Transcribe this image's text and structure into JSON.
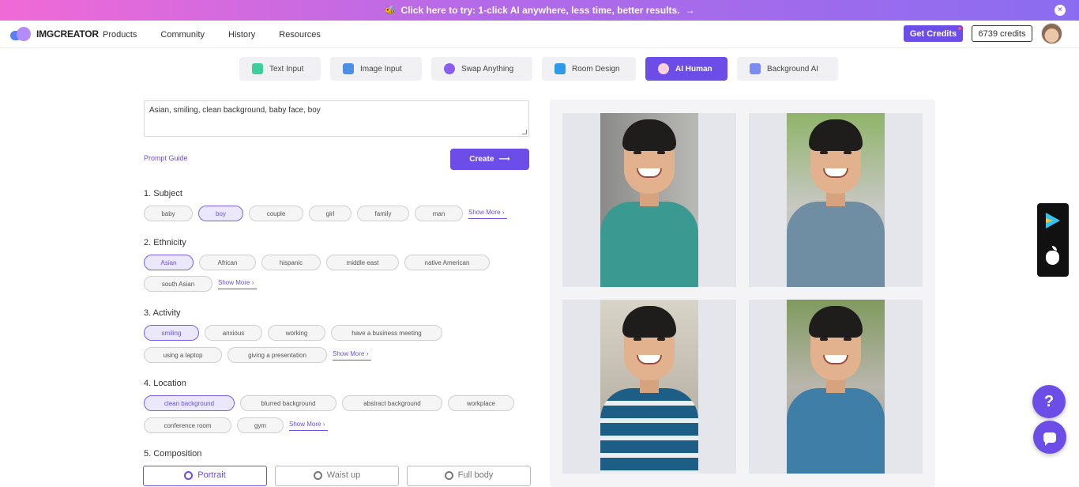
{
  "banner": {
    "text": "Click here to try: 1-click AI anywhere, less time, better results.",
    "arrow": "→",
    "close": "×"
  },
  "nav": {
    "logo": "IMGCREATOR",
    "links": [
      "Products",
      "Community",
      "History",
      "Resources"
    ],
    "get_credits": "Get Credits",
    "credits": "6739 credits"
  },
  "tabs": [
    {
      "label": "Text Input",
      "icon": "text-t-icon",
      "color": "#3ccf9b"
    },
    {
      "label": "Image Input",
      "icon": "image-icon",
      "color": "#4b8ee6"
    },
    {
      "label": "Swap Anything",
      "icon": "swap-icon",
      "color": "#8b5cf0"
    },
    {
      "label": "Room Design",
      "icon": "house-icon",
      "color": "#2d9be8"
    },
    {
      "label": "AI Human",
      "icon": "ai-human-icon",
      "color": "#ff6b8a"
    },
    {
      "label": "Background AI",
      "icon": "mountain-icon",
      "color": "#7a8cf0"
    }
  ],
  "prompt": {
    "value": "Asian, smiling, clean background, baby face, boy",
    "guide": "Prompt Guide",
    "create": "Create"
  },
  "sections": {
    "subject": {
      "title": "1. Subject",
      "chips": [
        "baby",
        "boy",
        "couple",
        "girl",
        "family",
        "man"
      ],
      "selected": "boy",
      "more": "Show More"
    },
    "ethnicity": {
      "title": "2. Ethnicity",
      "chips": [
        "Asian",
        "African",
        "hispanic",
        "middle east",
        "native American",
        "south Asian"
      ],
      "selected": "Asian",
      "more": "Show More"
    },
    "activity": {
      "title": "3. Activity",
      "chips": [
        "smiling",
        "anxious",
        "working",
        "have a business meeting",
        "using a laptop",
        "giving a presentation"
      ],
      "selected": "smiling",
      "more": "Show More"
    },
    "location": {
      "title": "4. Location",
      "chips": [
        "clean background",
        "blurred background",
        "abstract background",
        "workplace",
        "conference room",
        "gym"
      ],
      "selected": "clean background",
      "more": "Show More"
    },
    "composition": {
      "title": "5. Composition",
      "options": [
        "Portrait",
        "Waist up",
        "Full body"
      ],
      "selected": "Portrait"
    }
  },
  "floating": {
    "help": "?"
  }
}
